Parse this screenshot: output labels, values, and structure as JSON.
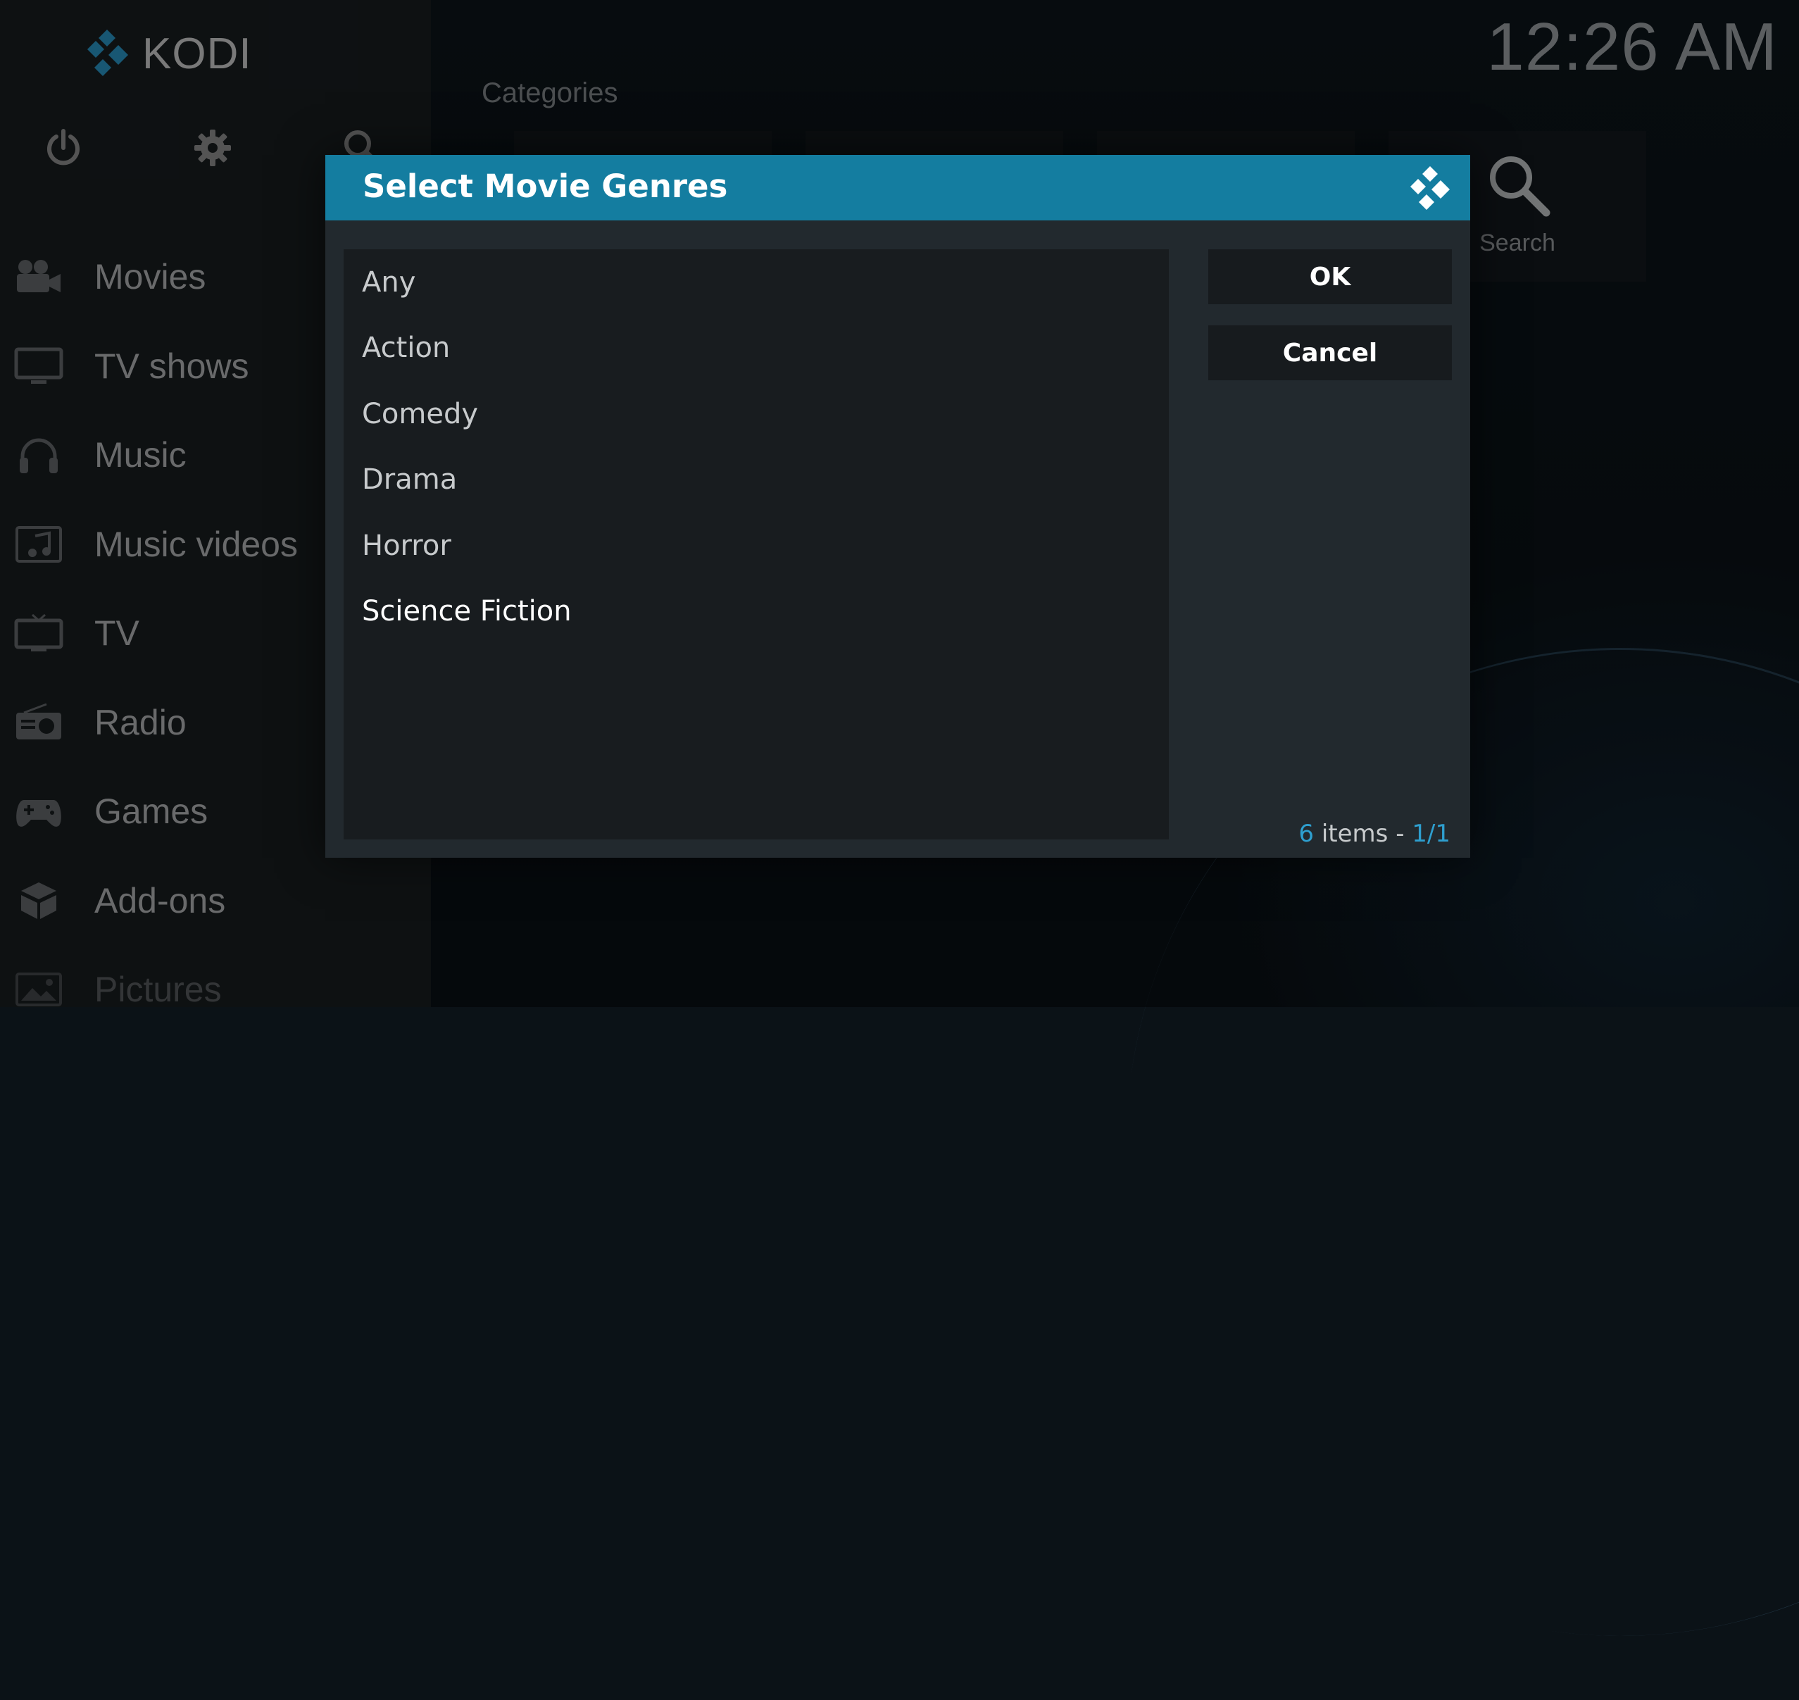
{
  "app": {
    "name": "KODI"
  },
  "clock": "12:26 AM",
  "top_icons": [
    "power-icon",
    "settings-icon",
    "search-icon"
  ],
  "sidebar": {
    "items": [
      {
        "label": "Movies",
        "icon": "movie-camera-icon"
      },
      {
        "label": "TV shows",
        "icon": "monitor-icon"
      },
      {
        "label": "Music",
        "icon": "headphones-icon"
      },
      {
        "label": "Music videos",
        "icon": "music-video-icon"
      },
      {
        "label": "TV",
        "icon": "tv-icon"
      },
      {
        "label": "Radio",
        "icon": "radio-icon"
      },
      {
        "label": "Games",
        "icon": "gamepad-icon"
      },
      {
        "label": "Add-ons",
        "icon": "addons-box-icon"
      },
      {
        "label": "Pictures",
        "icon": "picture-icon"
      }
    ]
  },
  "main": {
    "categories_label": "Categories",
    "search_tile": {
      "label": "Search",
      "icon": "search-icon"
    }
  },
  "dialog": {
    "title": "Select Movie Genres",
    "items": [
      "Any",
      "Action",
      "Comedy",
      "Drama",
      "Horror",
      "Science Fiction"
    ],
    "selected_index": 5,
    "ok_label": "OK",
    "cancel_label": "Cancel",
    "count": "6",
    "items_text": " items - ",
    "page": "1/1"
  },
  "colors": {
    "accent": "#147da0",
    "accent_text": "#2e9fcf",
    "sidebar_bg": "#1a1f22",
    "dialog_bg": "#22292e"
  }
}
